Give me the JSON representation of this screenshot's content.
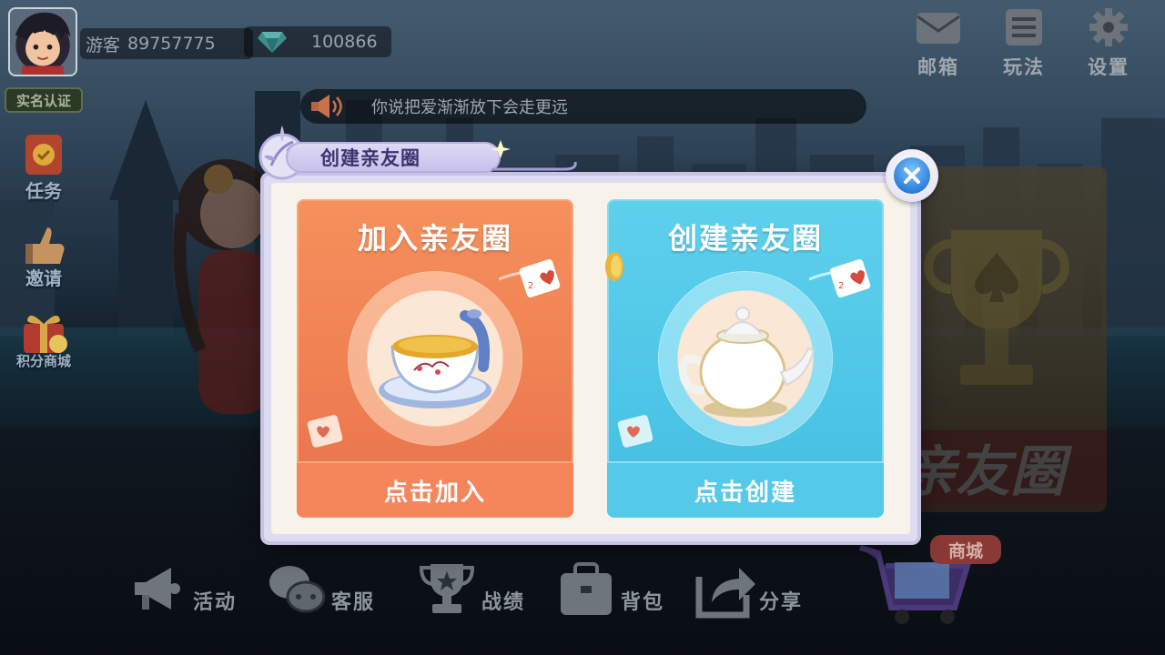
{
  "player": {
    "name_prefix": "游客",
    "id": "89757775",
    "diamonds": "100866"
  },
  "realname_label": "实名认证",
  "marquee_text": "你说把爱渐渐放下会走更远",
  "top_menu": [
    {
      "key": "mail",
      "label": "邮箱",
      "icon": "mail-icon"
    },
    {
      "key": "rules",
      "label": "玩法",
      "icon": "rules-icon"
    },
    {
      "key": "settings",
      "label": "设置",
      "icon": "gear-icon"
    }
  ],
  "side_menu": [
    {
      "key": "tasks",
      "label": "任务",
      "icon": "task-icon"
    },
    {
      "key": "invite",
      "label": "邀请",
      "icon": "invite-icon"
    },
    {
      "key": "points_mall",
      "label": "积分商城",
      "icon": "gift-icon"
    }
  ],
  "bottom_menu": [
    {
      "key": "events",
      "label": "活动",
      "icon": "megaphone-icon"
    },
    {
      "key": "service",
      "label": "客服",
      "icon": "chat-icon"
    },
    {
      "key": "record",
      "label": "战绩",
      "icon": "trophy-icon"
    },
    {
      "key": "bag",
      "label": "背包",
      "icon": "bag-icon"
    },
    {
      "key": "share",
      "label": "分享",
      "icon": "share-icon"
    }
  ],
  "shop_label": "商城",
  "promo_text": "亲友圈",
  "dialog": {
    "title": "创建亲友圈",
    "join": {
      "title": "加入亲友圈",
      "button": "点击加入",
      "icon": "teacup-icon"
    },
    "create": {
      "title": "创建亲友圈",
      "button": "点击创建",
      "icon": "teapot-icon"
    }
  },
  "colors": {
    "join_card": "#ef7f52",
    "create_card": "#4ec6e7",
    "dialog_frame": "#dedcf0",
    "close_button": "#2d7fdc"
  }
}
